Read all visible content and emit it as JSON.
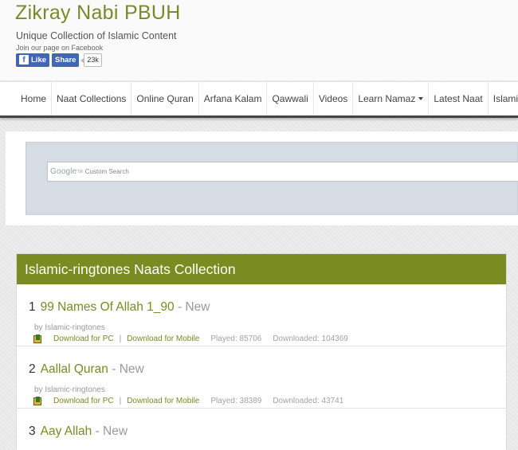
{
  "header": {
    "site_title": "Zikray Nabi PBUH",
    "tagline": "Unique Collection of Islamic Content",
    "facebook": {
      "join_text": "Join our page on Facebook",
      "like_label": "Like",
      "share_label": "Share",
      "count": "23k"
    }
  },
  "nav": {
    "items": [
      {
        "label": "Home"
      },
      {
        "label": "Naat Collections"
      },
      {
        "label": "Online Quran"
      },
      {
        "label": "Arfana Kalam"
      },
      {
        "label": "Qawwali"
      },
      {
        "label": "Videos"
      },
      {
        "label": "Learn Namaz"
      },
      {
        "label": "Latest Naat"
      },
      {
        "label": "Islamic Colle"
      }
    ]
  },
  "search": {
    "google_label": "Google",
    "tm": "TM",
    "placeholder": "Custom Search"
  },
  "collection": {
    "title": "Islamic-ringtones Naats Collection",
    "items": [
      {
        "number": "1",
        "name": "99 Names Of Allah 1_90",
        "badge": " - New",
        "by": "by Islamic-ringtones",
        "download_pc": "Download for PC",
        "separator": "|",
        "download_mobile": "Download for Mobile",
        "played": "Played: 85706",
        "downloaded": "Downloaded: 104369"
      },
      {
        "number": "2",
        "name": "Aallal Quran",
        "badge": " - New",
        "by": "by Islamic-ringtones",
        "download_pc": "Download for PC",
        "separator": "|",
        "download_mobile": "Download for Mobile",
        "played": "Played: 38389",
        "downloaded": "Downloaded: 43741"
      },
      {
        "number": "3",
        "name": "Aay Allah",
        "badge": " - New"
      }
    ]
  }
}
